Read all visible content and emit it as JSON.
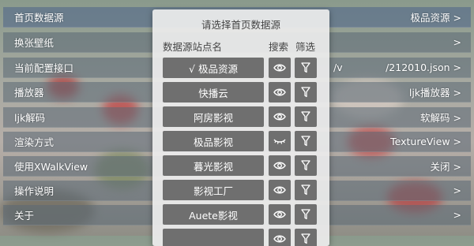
{
  "settings": {
    "rows": [
      {
        "label": "首页数据源",
        "value": "极品资源 >"
      },
      {
        "label": "换张壁纸",
        "value": ">"
      },
      {
        "label": "当前配置接口",
        "value": "/212010.json >",
        "url_fragment": "/v"
      },
      {
        "label": "播放器",
        "value": "ljk播放器 >"
      },
      {
        "label": "ljk解码",
        "value": "软解码 >"
      },
      {
        "label": "渲染方式",
        "value": "TextureView >"
      },
      {
        "label": "使用XWalkView",
        "value": "关闭 >"
      },
      {
        "label": "操作说明",
        "value": ">"
      },
      {
        "label": "关于",
        "value": ">"
      }
    ]
  },
  "dialog": {
    "title": "请选择首页数据源",
    "col_name": "数据源站点名",
    "col_search": "搜索",
    "col_filter": "筛选",
    "sources": [
      {
        "name": "√  极品资源",
        "search_icon": "eye-icon",
        "filter_icon": "filter-icon"
      },
      {
        "name": "快播云",
        "search_icon": "eye-icon",
        "filter_icon": "filter-icon"
      },
      {
        "name": "阿房影视",
        "search_icon": "eye-icon",
        "filter_icon": "filter-icon"
      },
      {
        "name": "极品影视",
        "search_icon": "eye-closed-icon",
        "filter_icon": "filter-icon"
      },
      {
        "name": "暮光影视",
        "search_icon": "eye-icon",
        "filter_icon": "filter-icon"
      },
      {
        "name": "影视工厂",
        "search_icon": "eye-icon",
        "filter_icon": "filter-icon"
      },
      {
        "name": "Auete影视",
        "search_icon": "eye-icon",
        "filter_icon": "filter-icon"
      },
      {
        "name": "",
        "search_icon": "eye-icon",
        "filter_icon": "filter-icon"
      }
    ]
  },
  "colors": {
    "row_bg": "#5a6874",
    "dialog_bg": "#ececec",
    "button_bg": "#6f6f6f",
    "text_on_button": "#ffffff"
  }
}
